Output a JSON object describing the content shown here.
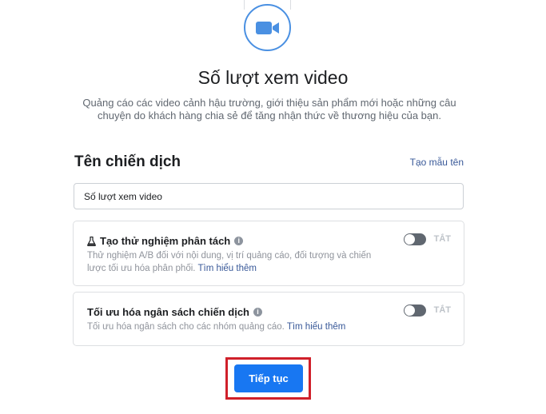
{
  "header": {
    "icon": "video-camera-icon",
    "title": "Số lượt xem video",
    "description": "Quảng cáo các video cảnh hậu trường, giới thiệu sản phẩm mới hoặc những câu chuyện do khách hàng chia sẻ để tăng nhận thức về thương hiệu của bạn."
  },
  "campaign": {
    "label": "Tên chiến dịch",
    "template_link": "Tạo mẫu tên",
    "name_value": "Số lượt xem video"
  },
  "split_test": {
    "icon": "flask-icon",
    "title": "Tạo thử nghiệm phân tách",
    "description": "Thử nghiệm A/B đối với nội dung, vị trí quảng cáo, đối tượng và chiến lược tối ưu hóa phân phối.",
    "learn_more": "Tìm hiểu thêm",
    "toggle_label": "TẮT",
    "toggle_on": false
  },
  "budget_optimization": {
    "title": "Tối ưu hóa ngân sách chiến dịch",
    "description": "Tối ưu hóa ngân sách cho các nhóm quảng cáo.",
    "learn_more": "Tìm hiểu thêm",
    "toggle_label": "TẮT",
    "toggle_on": false
  },
  "actions": {
    "continue_label": "Tiếp tục"
  },
  "colors": {
    "accent": "#1877f2",
    "link": "#385898",
    "highlight": "#d0202a",
    "icon_ring": "#4a90e2"
  }
}
